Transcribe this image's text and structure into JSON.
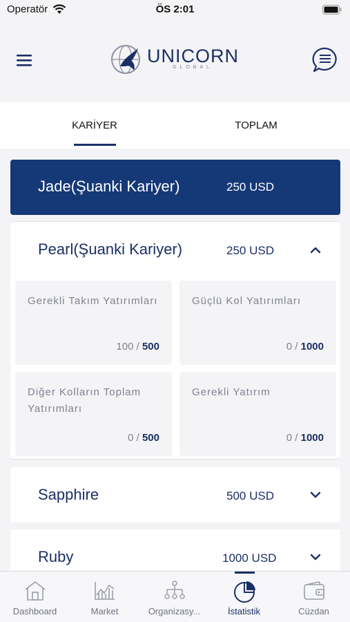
{
  "status_bar": {
    "carrier": "Operatör",
    "time": "ÖS 2:01"
  },
  "header": {
    "logo_text": "UNICORN",
    "logo_sub": "GLOBAL"
  },
  "tabs": [
    {
      "label": "KARİYER",
      "active": true
    },
    {
      "label": "TOPLAM",
      "active": false
    }
  ],
  "careers": {
    "current": {
      "name": "Jade(Şuanki Kariyer)",
      "amount": "250 USD"
    },
    "expanded": {
      "name": "Pearl(Şuanki Kariyer)",
      "amount": "250 USD",
      "requirements": [
        {
          "label": "Gerekli Takım Yatırımları",
          "current": "100",
          "sep": " / ",
          "target": "500"
        },
        {
          "label": "Güçlü Kol Yatırımları",
          "current": "0",
          "sep": " / ",
          "target": "1000"
        },
        {
          "label": "Diğer Kolların Toplam Yatırımları",
          "current": "0",
          "sep": " / ",
          "target": "500"
        },
        {
          "label": "Gerekli Yatırım",
          "current": "0",
          "sep": " / ",
          "target": "1000"
        }
      ]
    },
    "collapsed": [
      {
        "name": "Sapphire",
        "amount": "500 USD"
      },
      {
        "name": "Ruby",
        "amount": "1000 USD"
      }
    ]
  },
  "bottom_nav": [
    {
      "label": "Dashboard",
      "icon": "home-icon"
    },
    {
      "label": "Market",
      "icon": "chart-icon"
    },
    {
      "label": "Organizasy...",
      "icon": "org-tree-icon"
    },
    {
      "label": "İstatistik",
      "icon": "pie-chart-icon",
      "active": true
    },
    {
      "label": "Cüzdan",
      "icon": "wallet-icon"
    }
  ],
  "colors": {
    "primary": "#153877",
    "text": "#1b2f66",
    "muted": "#7e8290",
    "background": "#f4f4f6"
  }
}
